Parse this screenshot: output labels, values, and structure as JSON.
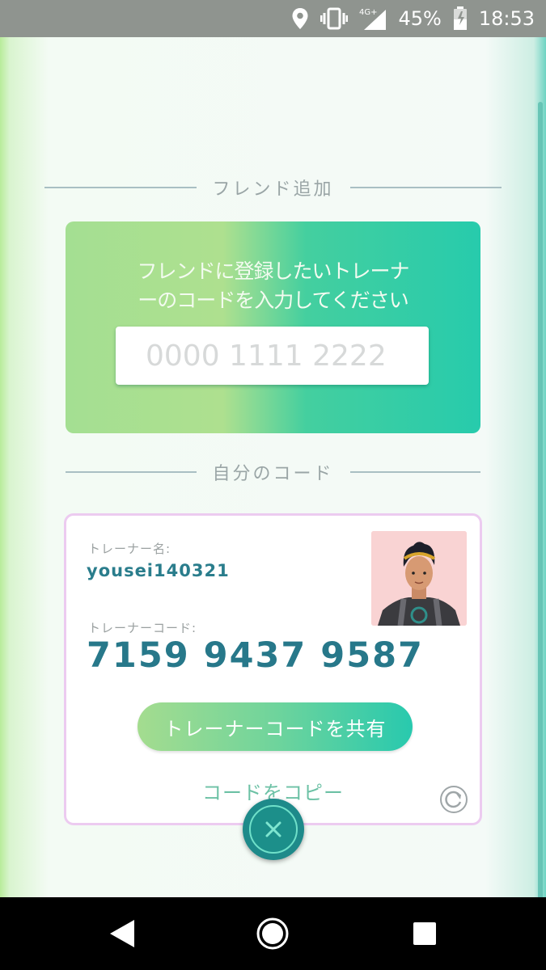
{
  "status_bar": {
    "network": "4G+",
    "battery_percent": "45%",
    "time": "18:53",
    "icons": [
      "location-icon",
      "vibrate-icon",
      "signal-icon",
      "battery-icon"
    ]
  },
  "friend_add": {
    "header": "フレンド追加",
    "instruction_line1": "フレンドに登録したいトレーナ",
    "instruction_line2": "ーのコードを入力してください",
    "input_placeholder": "0000 1111 2222",
    "input_value": ""
  },
  "my_code": {
    "header": "自分のコード",
    "trainer_name_label": "トレーナー名:",
    "trainer_name": "yousei140321",
    "trainer_code_label": "トレーナーコード:",
    "trainer_code": "7159 9437 9587",
    "share_button_label": "トレーナーコードを共有",
    "copy_link_label": "コードをコピー"
  },
  "colors": {
    "accent_teal": "#27788a",
    "card_gradient_start": "#a4df92",
    "card_gradient_end": "#27cbac",
    "card_border": "#eccbf0"
  },
  "nav_bar": {
    "icons": [
      "back-icon",
      "home-icon",
      "recents-icon"
    ]
  }
}
